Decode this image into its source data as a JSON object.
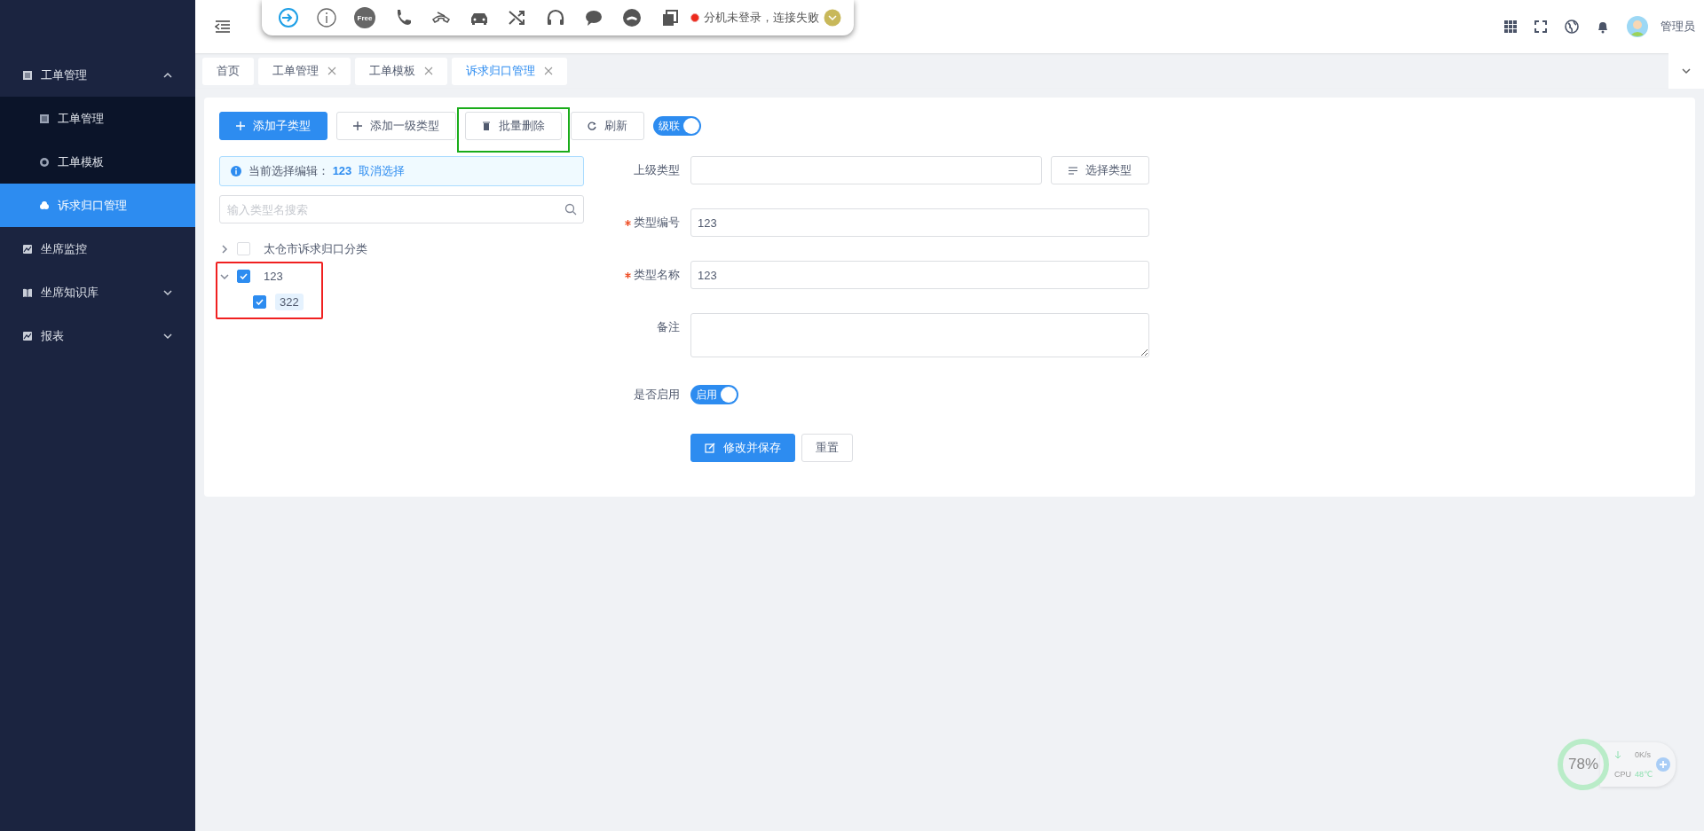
{
  "sidebar": {
    "items": [
      {
        "label": "工单管理",
        "kind": "group",
        "expanded": true,
        "children": [
          {
            "label": "工单管理",
            "selected": false
          },
          {
            "label": "工单模板",
            "selected": false
          },
          {
            "label": "诉求归口管理",
            "selected": true
          }
        ]
      },
      {
        "label": "坐席监控",
        "kind": "link"
      },
      {
        "label": "坐席知识库",
        "kind": "group",
        "expanded": false
      },
      {
        "label": "报表",
        "kind": "group",
        "expanded": false
      }
    ]
  },
  "phone_bar": {
    "free_label": "Free",
    "connected": false,
    "status": "分机未登录，连接失败"
  },
  "header": {
    "user": "管理员"
  },
  "tabs": [
    {
      "label": "首页",
      "closable": false,
      "selected": false
    },
    {
      "label": "工单管理",
      "closable": true,
      "selected": false
    },
    {
      "label": "工单模板",
      "closable": true,
      "selected": false
    },
    {
      "label": "诉求归口管理",
      "closable": true,
      "selected": true
    }
  ],
  "toolbar": {
    "buttons": [
      {
        "label": "添加子类型",
        "kind": "primary"
      },
      {
        "label": "添加一级类型",
        "kind": "default"
      },
      {
        "label": "批量删除",
        "kind": "default",
        "color": "#1aac1a"
      },
      {
        "label": "刷新",
        "kind": "default"
      }
    ],
    "cascade": {
      "label": "级联",
      "on": true
    }
  },
  "selection_alert": {
    "prefix": "当前选择编辑：",
    "value": "123",
    "link": "取消选择"
  },
  "search": {
    "placeholder": "输入类型名搜索"
  },
  "tree": [
    {
      "label": "太仓市诉求归口分类",
      "checked": false,
      "expanded": false,
      "selected": false
    },
    {
      "label": "123",
      "checked": true,
      "expanded": true,
      "selected": false,
      "color": "#f02020",
      "children": [
        {
          "label": "322",
          "checked": true,
          "selected": true
        }
      ]
    }
  ],
  "form": {
    "fields": [
      {
        "label": "上级类型",
        "required": false,
        "kind": "input",
        "button": "选择类型"
      },
      {
        "label": "类型编号",
        "required": true,
        "kind": "input",
        "value": "123"
      },
      {
        "label": "类型名称",
        "required": true,
        "kind": "input",
        "value": "123"
      },
      {
        "label": "备注",
        "required": false,
        "kind": "textarea"
      },
      {
        "label": "是否启用",
        "required": false,
        "kind": "switch",
        "on": true,
        "switch_label": "启用"
      }
    ],
    "actions": [
      {
        "label": "修改并保存",
        "kind": "primary"
      },
      {
        "label": "重置",
        "kind": "default"
      }
    ]
  },
  "monitor": {
    "percent": "78%",
    "speed": "0K/s",
    "cpu_label": "CPU",
    "temperature": "48℃"
  }
}
